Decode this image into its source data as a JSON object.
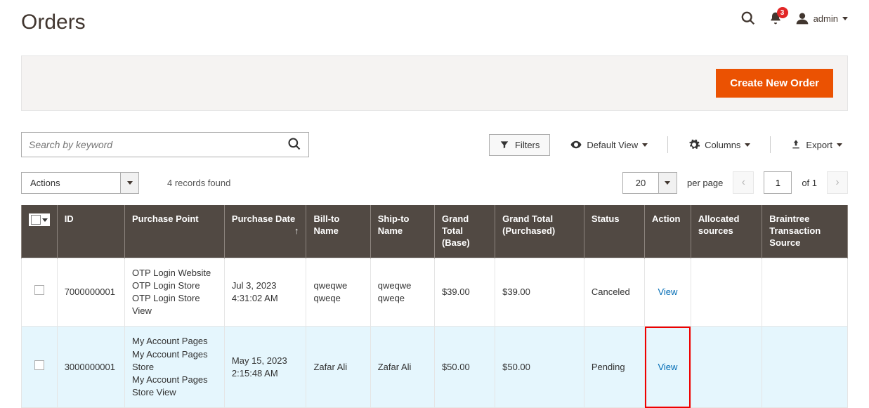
{
  "header": {
    "title": "Orders",
    "notifications_count": "3",
    "user": "admin"
  },
  "actions": {
    "create_order": "Create New Order"
  },
  "toolbar": {
    "search_placeholder": "Search by keyword",
    "filters_label": "Filters",
    "view_label": "Default View",
    "columns_label": "Columns",
    "export_label": "Export"
  },
  "grid_controls": {
    "actions_label": "Actions",
    "records_found": "4 records found",
    "page_size": "20",
    "per_page_label": "per page",
    "current_page": "1",
    "of_pages": "of 1"
  },
  "columns": {
    "id": "ID",
    "purchase_point": "Purchase Point",
    "purchase_date": "Purchase Date",
    "bill_to": "Bill-to Name",
    "ship_to": "Ship-to Name",
    "gt_base": "Grand Total (Base)",
    "gt_purchased": "Grand Total (Purchased)",
    "status": "Status",
    "action": "Action",
    "allocated": "Allocated sources",
    "braintree": "Braintree Transaction Source"
  },
  "rows": [
    {
      "id": "7000000001",
      "purchase_point": "OTP Login Website\n   OTP Login Store\n      OTP Login Store View",
      "purchase_date": "Jul 3, 2023 4:31:02 AM",
      "bill_to": "qweqwe qweqe",
      "ship_to": "qweqwe qweqe",
      "gt_base": "$39.00",
      "gt_purchased": "$39.00",
      "status": "Canceled",
      "action": "View",
      "allocated": "",
      "braintree": ""
    },
    {
      "id": "3000000001",
      "purchase_point": "My Account Pages\n   My Account Pages Store\n      My Account Pages Store View",
      "purchase_date": "May 15, 2023 2:15:48 AM",
      "bill_to": "Zafar Ali",
      "ship_to": "Zafar Ali",
      "gt_base": "$50.00",
      "gt_purchased": "$50.00",
      "status": "Pending",
      "action": "View",
      "allocated": "",
      "braintree": ""
    }
  ]
}
